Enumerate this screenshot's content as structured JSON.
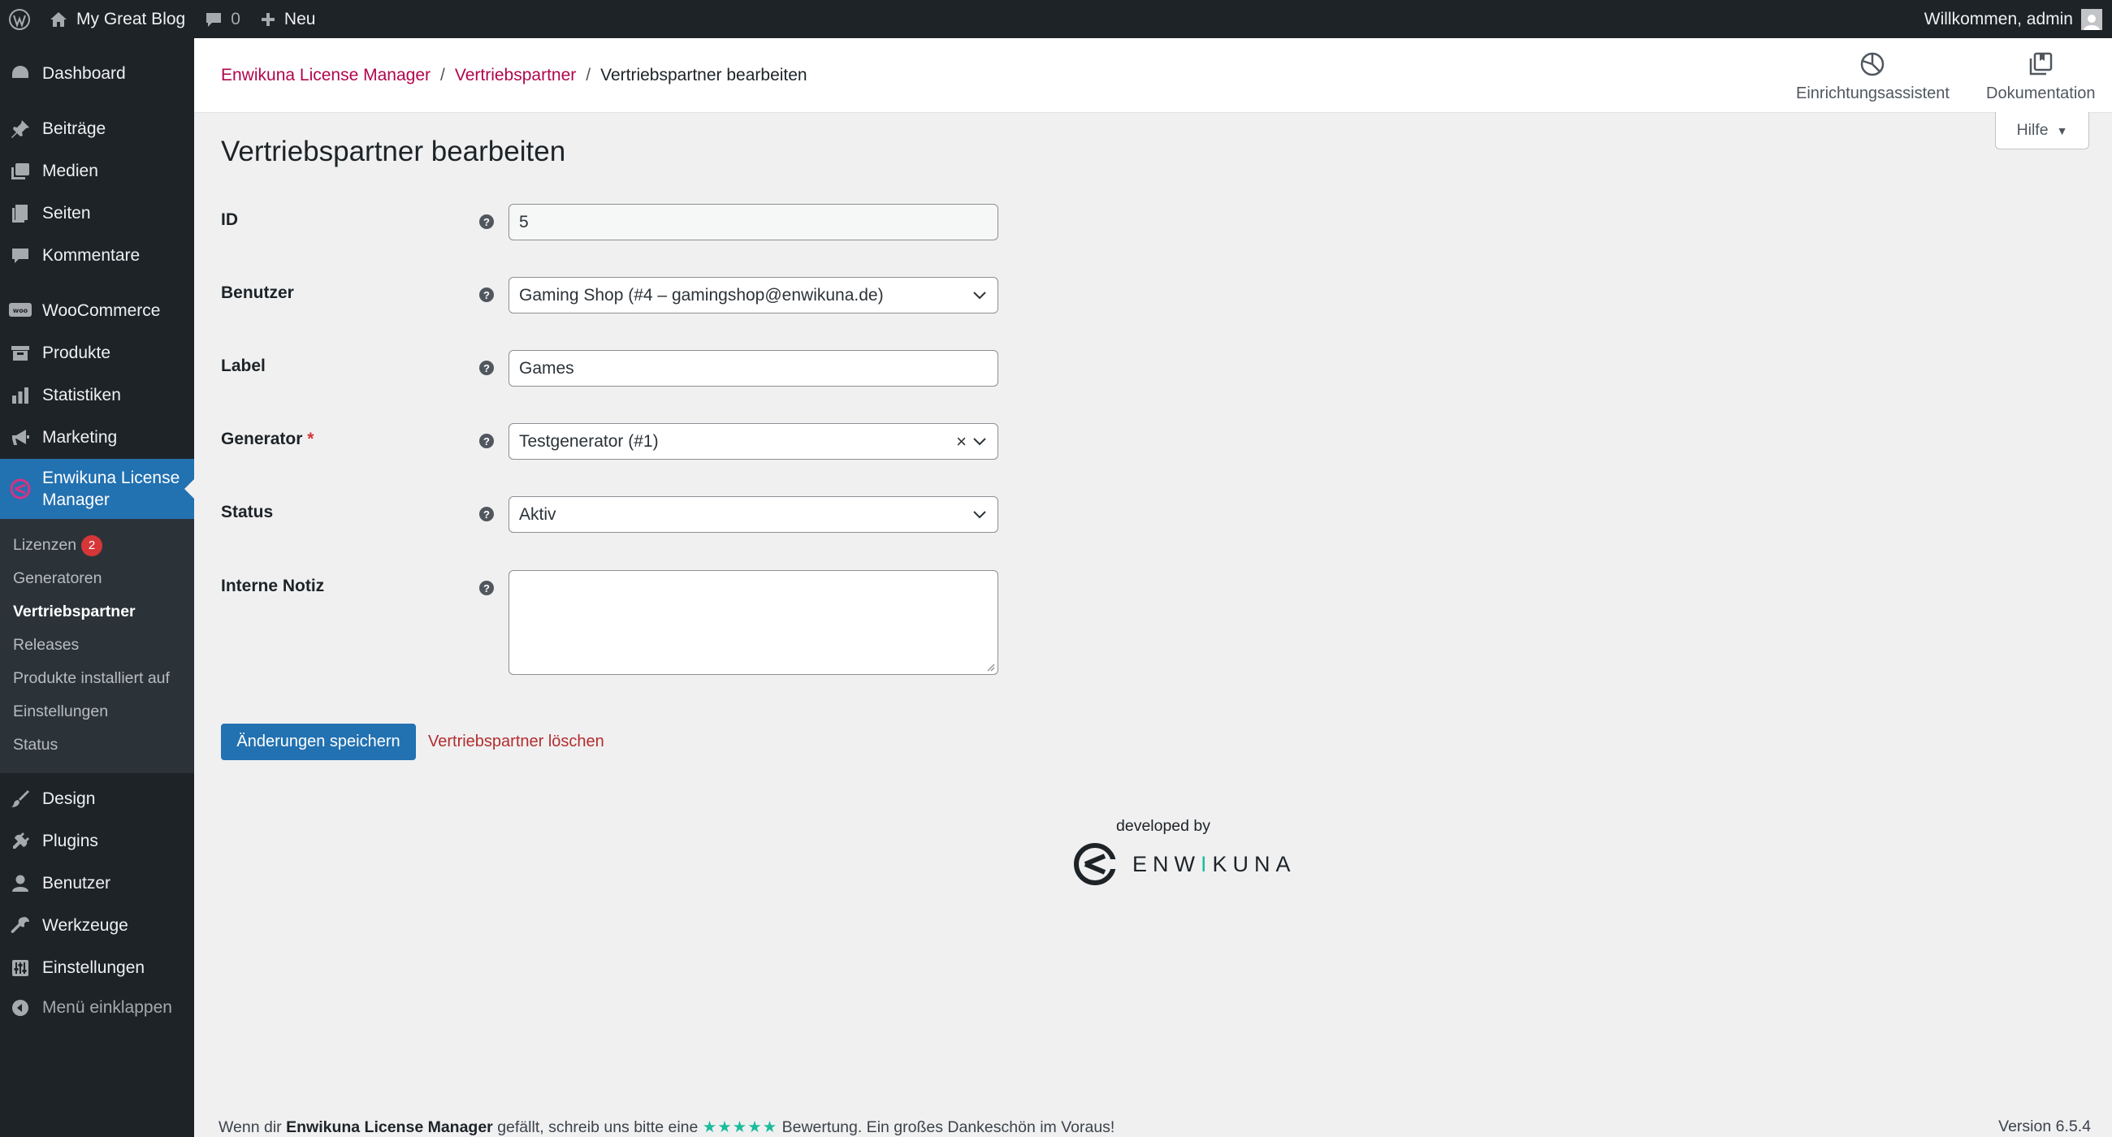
{
  "adminbar": {
    "site_name": "My Great Blog",
    "comments_count": "0",
    "new_label": "Neu",
    "welcome": "Willkommen, admin"
  },
  "sidebar": {
    "items": [
      {
        "label": "Dashboard",
        "icon": "dashboard-icon"
      },
      {
        "label": "Beiträge",
        "icon": "pin-icon"
      },
      {
        "label": "Medien",
        "icon": "media-icon"
      },
      {
        "label": "Seiten",
        "icon": "pages-icon"
      },
      {
        "label": "Kommentare",
        "icon": "comment-icon"
      },
      {
        "label": "WooCommerce",
        "icon": "woo-icon"
      },
      {
        "label": "Produkte",
        "icon": "archive-icon"
      },
      {
        "label": "Statistiken",
        "icon": "chart-icon"
      },
      {
        "label": "Marketing",
        "icon": "megaphone-icon"
      },
      {
        "label": "Enwikuna License Manager",
        "icon": "enwikuna-icon"
      },
      {
        "label": "Design",
        "icon": "brush-icon"
      },
      {
        "label": "Plugins",
        "icon": "plugin-icon"
      },
      {
        "label": "Benutzer",
        "icon": "user-icon"
      },
      {
        "label": "Werkzeuge",
        "icon": "wrench-icon"
      },
      {
        "label": "Einstellungen",
        "icon": "settings-icon"
      },
      {
        "label": "Menü einklappen",
        "icon": "collapse-icon"
      }
    ],
    "submenu": [
      {
        "label": "Lizenzen",
        "badge": "2"
      },
      {
        "label": "Generatoren"
      },
      {
        "label": "Vertriebspartner"
      },
      {
        "label": "Releases"
      },
      {
        "label": "Produkte installiert auf"
      },
      {
        "label": "Einstellungen"
      },
      {
        "label": "Status"
      }
    ]
  },
  "header": {
    "breadcrumb": [
      "Enwikuna License Manager",
      "Vertriebspartner",
      "Vertriebspartner bearbeiten"
    ],
    "setup_wizard": "Einrichtungsassistent",
    "documentation": "Dokumentation",
    "help": "Hilfe"
  },
  "form": {
    "title": "Vertriebspartner bearbeiten",
    "id_label": "ID",
    "id_value": "5",
    "user_label": "Benutzer",
    "user_value": "Gaming Shop (#4 – gamingshop@enwikuna.de)",
    "label_label": "Label",
    "label_value": "Games",
    "generator_label": "Generator",
    "generator_required": "*",
    "generator_value": "Testgenerator (#1)",
    "status_label": "Status",
    "status_value": "Aktiv",
    "note_label": "Interne Notiz",
    "note_value": "",
    "save_label": "Änderungen speichern",
    "delete_label": "Vertriebspartner löschen"
  },
  "branding": {
    "developed_by": "developed by",
    "logo_text_1": "ENW",
    "logo_text_accent": "I",
    "logo_text_2": "KUNA",
    "accent_color": "#1abc9c"
  },
  "footer": {
    "text_before": "Wenn dir",
    "plugin_name": "Enwikuna License Manager",
    "text_middle": "gefällt, schreib uns bitte eine",
    "stars": "★★★★★",
    "text_after": "Bewertung. Ein großes Dankeschön im Voraus!",
    "version": "Version 6.5.4"
  }
}
